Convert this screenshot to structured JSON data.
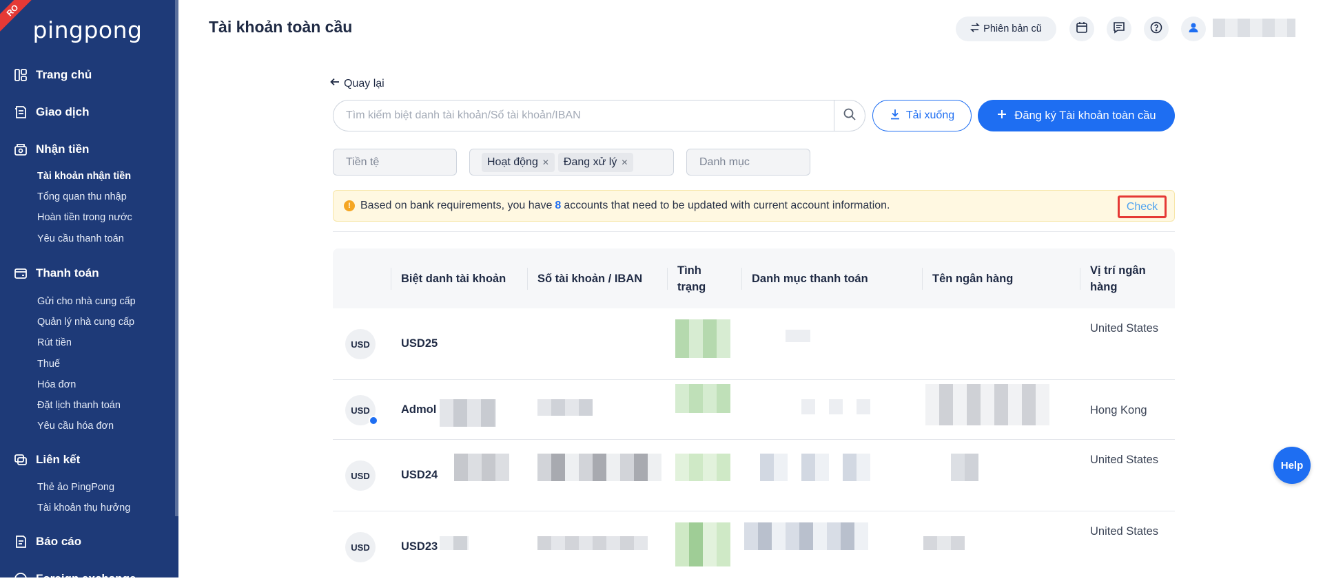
{
  "sidebar": {
    "ribbon": "RO",
    "logo": "pingpong",
    "groups": [
      {
        "label": "Trang chủ",
        "icon": "home-icon"
      },
      {
        "label": "Giao dịch",
        "icon": "transactions-icon"
      },
      {
        "label": "Nhận tiền",
        "icon": "receive-icon",
        "items": [
          "Tài khoản nhận tiền",
          "Tổng quan thu nhập",
          "Hoàn tiền trong nước",
          "Yêu cầu thanh toán"
        ]
      },
      {
        "label": "Thanh toán",
        "icon": "wallet-icon",
        "items": [
          "Gửi cho nhà cung cấp",
          "Quản lý nhà cung cấp",
          "Rút tiền",
          "Thuế",
          "Hóa đơn",
          "Đặt lịch thanh toán",
          "Yêu cầu hóa đơn"
        ]
      },
      {
        "label": "Liên kết",
        "icon": "link-icon",
        "items": [
          "Thẻ ảo PingPong",
          "Tài khoản thụ hưởng"
        ]
      },
      {
        "label": "Báo cáo",
        "icon": "report-icon"
      },
      {
        "label": "Foreign exchange",
        "icon": "exchange-icon"
      }
    ],
    "active_item": "Tài khoản nhận tiền"
  },
  "header": {
    "title": "Tài khoản toàn cầu",
    "old_version": "Phiên bản cũ",
    "icons": [
      "calendar-icon",
      "message-icon",
      "help-circle-icon",
      "user-icon"
    ]
  },
  "main": {
    "back": "Quay lại",
    "search": {
      "placeholder": "Tìm kiếm biệt danh tài khoản/Số tài khoản/IBAN",
      "value": ""
    },
    "download": "Tải xuống",
    "register": "Đăng ký Tài khoản toàn cầu",
    "filters": {
      "currency": "Tiền tệ",
      "status_chips": [
        "Hoạt động",
        "Đang xử lý"
      ],
      "category": "Danh mục"
    },
    "notice": {
      "before": "Based on bank requirements, you have",
      "count": "8",
      "after": "accounts that need to be updated with current account information.",
      "check": "Check"
    },
    "table": {
      "headers": [
        "Biệt danh tài khoản",
        "Số tài khoản / IBAN",
        "Tình trạng",
        "Danh mục thanh toán",
        "Tên ngân hàng",
        "Vị trí ngân hàng"
      ],
      "rows": [
        {
          "currency": "USD",
          "nickname": "USD25",
          "location": "United States"
        },
        {
          "currency": "USD",
          "nickname": "Admol",
          "location": "Hong Kong"
        },
        {
          "currency": "USD",
          "nickname": "USD24",
          "location": "United States"
        },
        {
          "currency": "USD",
          "nickname": "USD23",
          "location": "United States"
        }
      ]
    }
  },
  "help_button": "Help",
  "colors": {
    "sidebar": "#1e3a78",
    "primary": "#1e6ef2",
    "warning": "#f5a623",
    "highlight": "#e53935"
  }
}
